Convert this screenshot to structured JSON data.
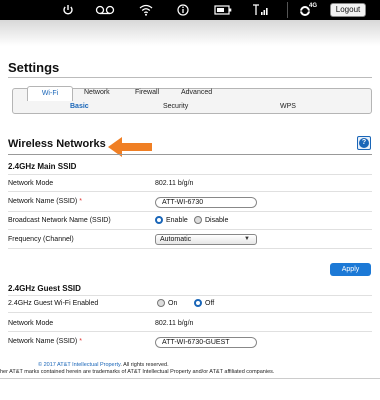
{
  "topbar": {
    "icons": [
      "power-icon",
      "voicemail-icon",
      "wifi-icon",
      "info-icon",
      "battery-icon",
      "signal-icon",
      "network-4g-icon"
    ],
    "network_label": "4G",
    "logout_label": "Logout"
  },
  "page": {
    "title": "Settings"
  },
  "tabs": [
    {
      "label": "Wi-Fi",
      "active": true
    },
    {
      "label": "Network",
      "active": false
    },
    {
      "label": "Firewall",
      "active": false
    },
    {
      "label": "Advanced",
      "active": false
    }
  ],
  "subtabs": [
    {
      "label": "Basic",
      "active": true
    },
    {
      "label": "Security",
      "active": false
    },
    {
      "label": "WPS",
      "active": false
    }
  ],
  "section": {
    "title": "Wireless Networks",
    "help_label": "?",
    "arrow_color": "#f07f24"
  },
  "main_ssid": {
    "title": "2.4GHz Main SSID",
    "network_mode_label": "Network Mode",
    "network_mode_value": "802.11 b/g/n",
    "network_name_label": "Network Name (SSID)",
    "required_mark": "*",
    "network_name_value": "ATT-WI-6730",
    "broadcast_label": "Broadcast Network Name (SSID)",
    "broadcast_options": [
      "Enable",
      "Disable"
    ],
    "broadcast_selected": "Enable",
    "frequency_label": "Frequency (Channel)",
    "frequency_value": "Automatic"
  },
  "apply_label": "Apply",
  "guest_ssid": {
    "title": "2.4GHz Guest SSID",
    "enabled_label": "2.4GHz Guest Wi-Fi Enabled",
    "enabled_options": [
      "On",
      "Off"
    ],
    "enabled_selected": "Off",
    "network_mode_label": "Network Mode",
    "network_mode_value": "802.11 b/g/n",
    "network_name_label": "Network Name (SSID)",
    "required_mark": "*",
    "network_name_value": "ATT-WI-6730-GUEST"
  },
  "footer": {
    "copyright": "© 2017 AT&T Intellectual Property",
    "rights": ". All rights reserved.",
    "trademark": "her AT&T marks contained herein are trademarks of AT&T Intellectual Property and/or AT&T affiliated companies."
  },
  "colors": {
    "accent": "#1a66b8",
    "apply_button": "#1c79d6",
    "arrow": "#f07f24",
    "required": "#e0302c"
  }
}
